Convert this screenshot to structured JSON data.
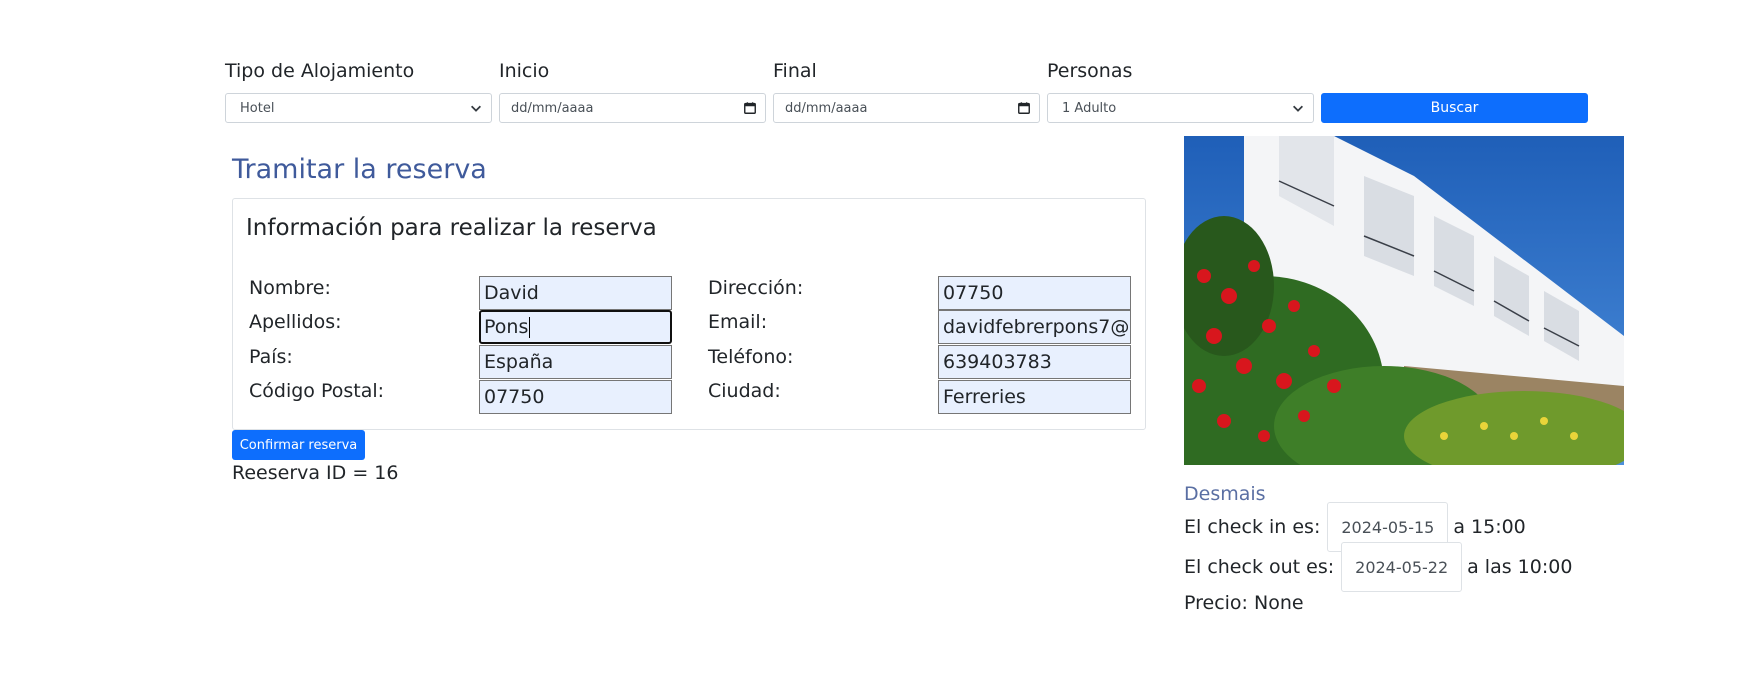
{
  "search": {
    "tipo_label": "Tipo de Alojamiento",
    "tipo_value": "Hotel",
    "inicio_label": "Inicio",
    "inicio_placeholder": "dd/mm/aaaa",
    "final_label": "Final",
    "final_placeholder": "dd/mm/aaaa",
    "personas_label": "Personas",
    "personas_value": "1 Adulto",
    "buscar_label": "Buscar"
  },
  "page_title": "Tramitar la reserva",
  "form": {
    "title": "Información para realizar la reserva",
    "nombre_label": "Nombre:",
    "nombre_value": "David",
    "apellidos_label": "Apellidos:",
    "apellidos_value": "Pons",
    "pais_label": "País:",
    "pais_value": "España",
    "cp_label": "Código Postal:",
    "cp_value": "07750",
    "direccion_label": "Dirección:",
    "direccion_value": "07750",
    "email_label": "Email:",
    "email_value": "davidfebrerpons7@",
    "telefono_label": "Teléfono:",
    "telefono_value": "639403783",
    "ciudad_label": "Ciudad:",
    "ciudad_value": "Ferreries"
  },
  "confirm_label": "Confirmar reserva",
  "reserva_id": "Reeserva ID = 16",
  "hotel": {
    "name": "Desmais",
    "checkin_prefix": "El check in es:",
    "checkin_date": "2024-05-15",
    "checkin_suffix": "a 15:00",
    "checkout_prefix": "El check out es:",
    "checkout_date": "2024-05-22",
    "checkout_suffix": "a las 10:00",
    "precio": "Precio: None"
  },
  "colors": {
    "primary": "#0d6efd",
    "title": "#3f5a9b",
    "autofill": "#e8f0fe"
  }
}
